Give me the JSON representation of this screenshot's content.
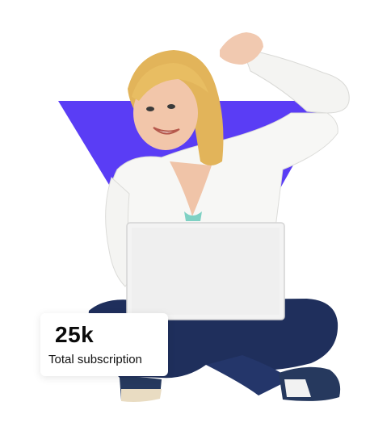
{
  "stat": {
    "value": "25k",
    "label": "Total subscription"
  },
  "colors": {
    "accent": "#5a3df5",
    "background": "#ffffff"
  },
  "hero": {
    "image": "photo-woman-with-laptop"
  }
}
